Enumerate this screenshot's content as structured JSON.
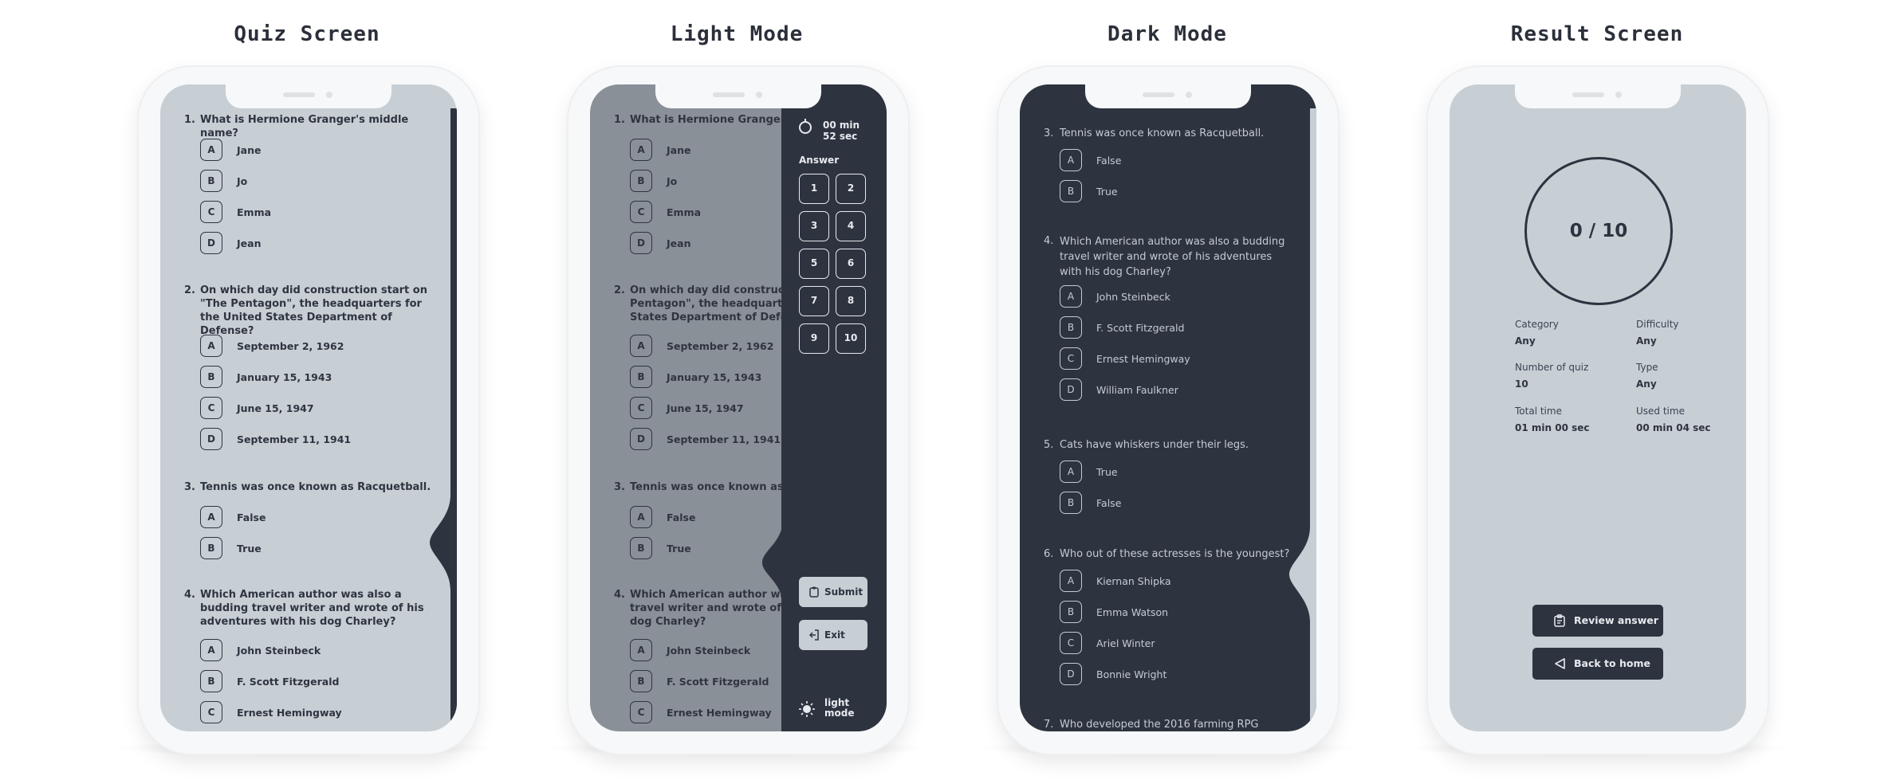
{
  "titles": {
    "quiz": "Quiz Screen",
    "light": "Light Mode",
    "dark": "Dark Mode",
    "result": "Result Screen"
  },
  "colors": {
    "light_bg": "#c7cfd5",
    "dark_bg": "#2e3340",
    "overlay": "#8a9098",
    "text_dark": "#2f3440",
    "text_light": "#c4ccd3"
  },
  "quiz": {
    "q1": {
      "num": "1.",
      "text": "What is Hermione Granger's middle name?",
      "options": [
        "Jane",
        "Jo",
        "Emma",
        "Jean"
      ]
    },
    "q2": {
      "num": "2.",
      "text": "On which day did construction start on \"The Pentagon\", the headquarters for the United States Department of Defense?",
      "options": [
        "September 2, 1962",
        "January 15, 1943",
        "June 15, 1947",
        "September 11, 1941"
      ]
    },
    "q3": {
      "num": "3.",
      "text": "Tennis was once known as Racquetball.",
      "options": [
        "False",
        "True"
      ]
    },
    "q4": {
      "num": "4.",
      "text": "Which American author was also a budding travel writer and wrote of his adventures with his dog Charley?",
      "options": [
        "John Steinbeck",
        "F. Scott Fitzgerald",
        "Ernest Hemingway",
        "William Faulkner"
      ]
    },
    "q5": {
      "num": "5.",
      "text": "Cats have whiskers under their legs.",
      "options": [
        "True",
        "False"
      ]
    },
    "q6": {
      "num": "6.",
      "text": "Who out of these actresses is the youngest?",
      "options": [
        "Kiernan Shipka",
        "Emma Watson",
        "Ariel Winter",
        "Bonnie Wright"
      ]
    },
    "q7": {
      "num": "7.",
      "text": "Who developed the 2016 farming RPG"
    },
    "letters": [
      "A",
      "B",
      "C",
      "D"
    ]
  },
  "light_mode": {
    "q2_text": "On which day did construction start on \"The Pentagon\", the headquarters for the United States Department of Defense?",
    "q2_lines": [
      "On which day did construction st",
      "Pentagon\", the headquarters for",
      "States Department of Defense?"
    ],
    "q1_short": "What is Hermione Granger's mid",
    "q3_short": "Tennis was once known as Racqu",
    "q4_lines": [
      "Which American author was als",
      "travel writer and wrote of his ad",
      "dog Charley?"
    ]
  },
  "panel": {
    "timer_min": "00 min",
    "timer_sec": "52 sec",
    "answer_label": "Answer",
    "numbers": [
      "1",
      "2",
      "3",
      "4",
      "5",
      "6",
      "7",
      "8",
      "9",
      "10"
    ],
    "submit": "Submit",
    "exit": "Exit",
    "mode_line1": "light",
    "mode_line2": "mode"
  },
  "result": {
    "score": "0 / 10",
    "category_label": "Category",
    "category_value": "Any",
    "difficulty_label": "Difficulty",
    "difficulty_value": "Any",
    "number_label": "Number of quiz",
    "number_value": "10",
    "type_label": "Type",
    "type_value": "Any",
    "total_time_label": "Total time",
    "total_time_value": "01 min 00 sec",
    "used_time_label": "Used time",
    "used_time_value": "00 min 04 sec",
    "review_button": "Review answer",
    "home_button": "Back to home"
  }
}
